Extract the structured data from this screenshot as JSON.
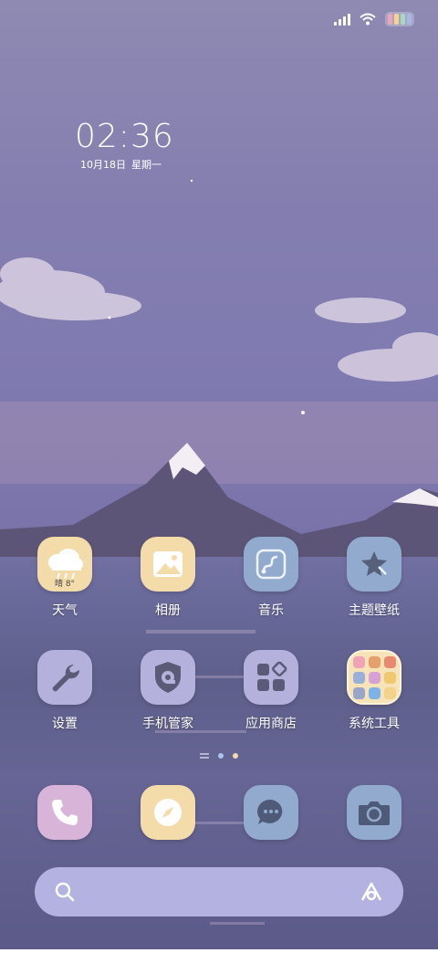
{
  "status_bar": {
    "signal_icon": "signal-bars-icon",
    "wifi_icon": "wifi-icon",
    "battery_icon": "battery-icon",
    "battery_colors": [
      "#f2a3b6",
      "#f6d48f",
      "#a8d8c2",
      "#a6b8e8"
    ]
  },
  "clock": {
    "time": "02:36",
    "date": "10月18日",
    "weekday": "星期一"
  },
  "apps": [
    {
      "label": "天气",
      "icon": "weather-rain-icon",
      "badge": "晴 8°",
      "color": "#f3dcaa"
    },
    {
      "label": "相册",
      "icon": "gallery-icon",
      "color": "#f3dcaa"
    },
    {
      "label": "音乐",
      "icon": "music-icon",
      "color": "#91aacd"
    },
    {
      "label": "主题壁纸",
      "icon": "theme-star-icon",
      "color": "#91aacd"
    },
    {
      "label": "设置",
      "icon": "wrench-icon",
      "color": "#b4b2dc"
    },
    {
      "label": "手机管家",
      "icon": "shield-icon",
      "color": "#b4b2dc"
    },
    {
      "label": "应用商店",
      "icon": "app-store-icon",
      "color": "#b4b2dc"
    },
    {
      "label": "系统工具",
      "icon": "folder-icon",
      "color": "#f6e3b8"
    }
  ],
  "page_indicator": {
    "current": 2,
    "total": 2
  },
  "dock": [
    {
      "icon": "phone-icon",
      "color": "#d9b4d9"
    },
    {
      "icon": "compass-browser-icon",
      "color": "#f3dcaa"
    },
    {
      "icon": "message-icon",
      "color": "#91aacd"
    },
    {
      "icon": "camera-icon",
      "color": "#91aacd"
    }
  ],
  "search_bar": {
    "left_icon": "search-icon",
    "right_icon": "assistant-logo-icon"
  }
}
